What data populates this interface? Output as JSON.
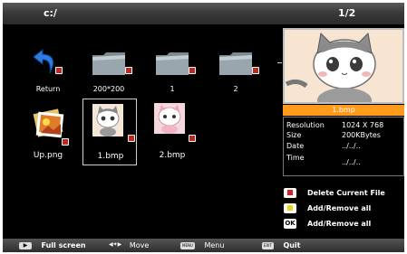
{
  "header": {
    "path": "c:/",
    "page": "1/2"
  },
  "items": [
    {
      "label": "Return",
      "icon": "return-arrow-icon"
    },
    {
      "label": "200*200",
      "icon": "folder-icon"
    },
    {
      "label": "1",
      "icon": "folder-icon"
    },
    {
      "label": "2",
      "icon": "folder-icon"
    },
    {
      "label": "Up.png",
      "icon": "photo-stack-icon"
    },
    {
      "label": "1.bmp",
      "icon": "cat-image-icon"
    },
    {
      "label": "2.bmp",
      "icon": "cat-image-icon"
    }
  ],
  "preview": {
    "filename": "1.bmp",
    "info": [
      {
        "key": "Resolution",
        "value": "1024 X 768"
      },
      {
        "key": "Size",
        "value": "200KBytes"
      },
      {
        "key": "Date",
        "value": "../../.."
      },
      {
        "key": "Time",
        "value": "../../.."
      }
    ]
  },
  "legend": [
    {
      "label": "Delete Current File",
      "color": "#d32020",
      "key": ""
    },
    {
      "label": "Add/Remove all",
      "color": "#f3d21a",
      "key": ""
    },
    {
      "label": "Add/Remove all",
      "color": "",
      "key": "OK"
    }
  ],
  "footer": {
    "full_screen": "Full screen",
    "move": "Move",
    "menu": "Menu",
    "menu_key": "MENU",
    "quit": "Quit",
    "exit_key": "EXIT"
  },
  "colors": {
    "accent": "#ff9a1a",
    "check": "#c0281e"
  }
}
